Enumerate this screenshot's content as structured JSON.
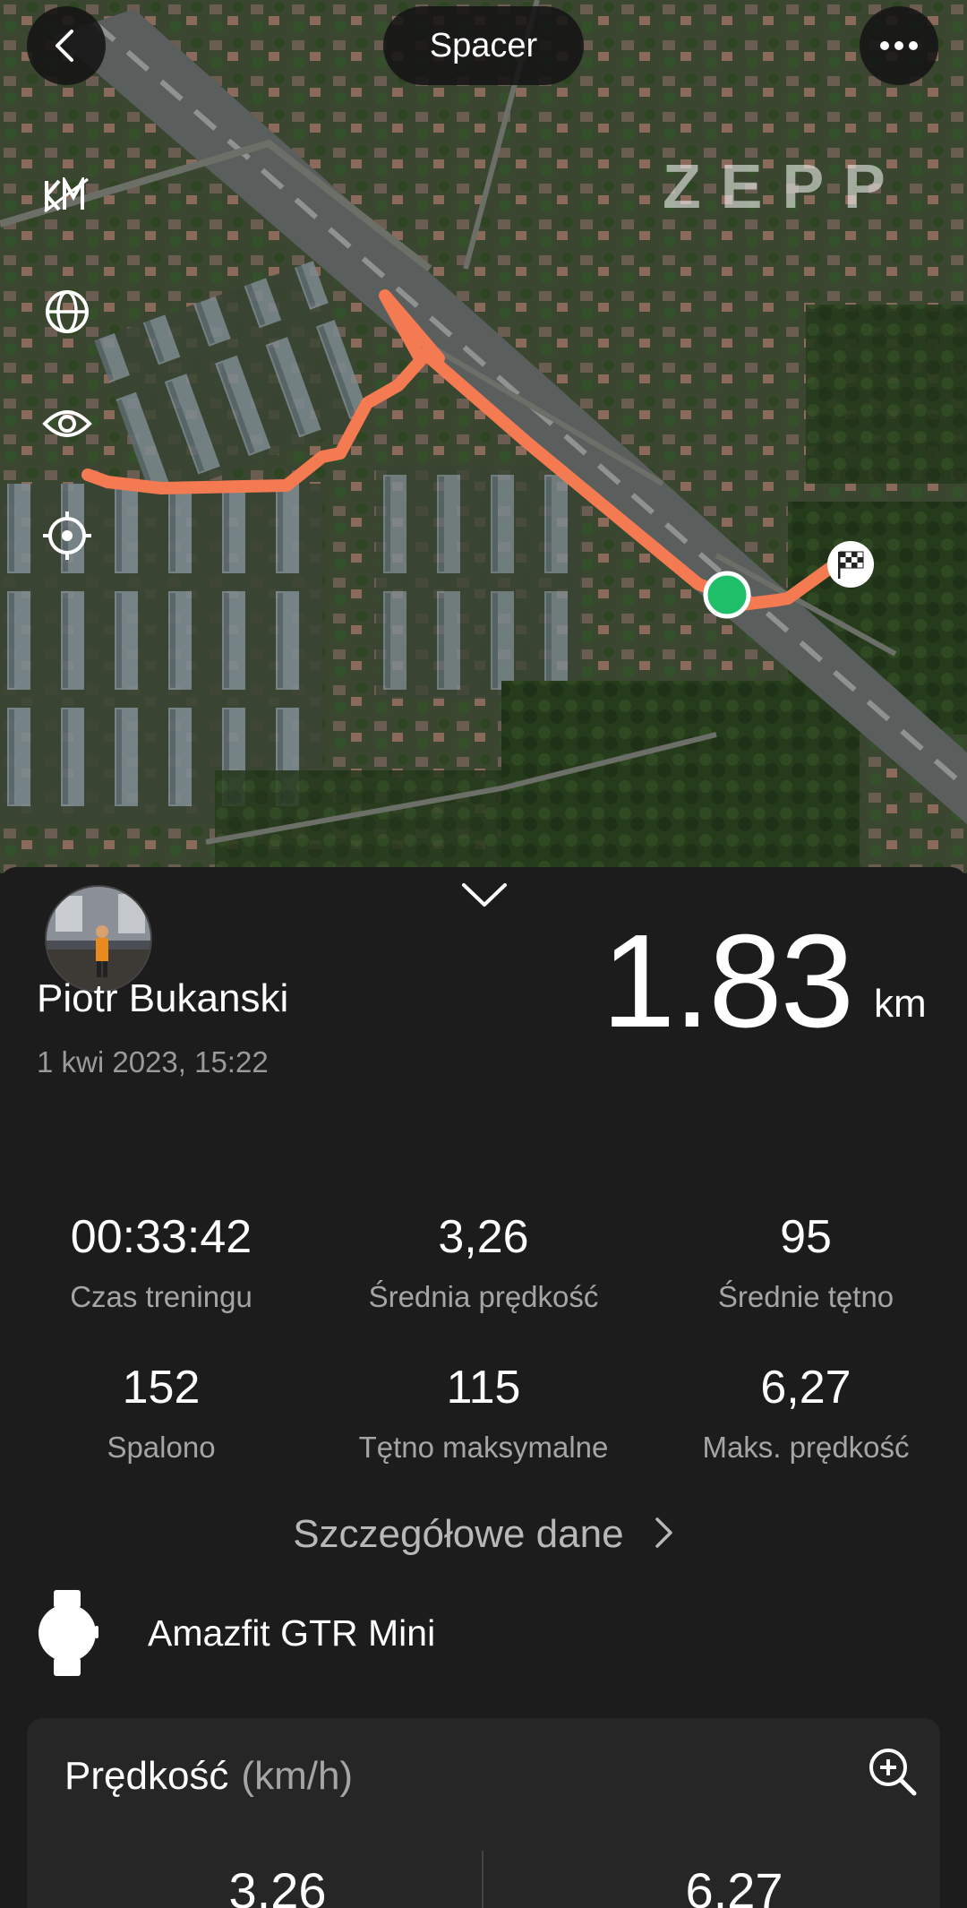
{
  "header": {
    "activity_type": "Spacer",
    "back_icon": "chevron-left-icon",
    "more_icon": "more-horizontal-icon"
  },
  "map": {
    "brand": "ZEPP",
    "tools": [
      "km-markers-icon",
      "globe-icon",
      "eye-icon",
      "locate-icon"
    ],
    "route_color": "#f47a52",
    "start_color": "#1fbf6a"
  },
  "summary": {
    "user_name": "Piotr Bukanski",
    "date": "1 kwi 2023, 15:22",
    "distance_value": "1.83",
    "distance_unit": "km"
  },
  "stats": [
    {
      "value": "00:33:42",
      "label": "Czas treningu"
    },
    {
      "value": "3,26",
      "label": "Średnia prędkość"
    },
    {
      "value": "95",
      "label": "Średnie tętno"
    },
    {
      "value": "152",
      "label": "Spalono"
    },
    {
      "value": "115",
      "label": "Tętno maksymalne"
    },
    {
      "value": "6,27",
      "label": "Maks. prędkość"
    }
  ],
  "details_link": "Szczegółowe dane",
  "device": {
    "name": "Amazfit GTR Mini",
    "icon": "watch-icon"
  },
  "speed_card": {
    "title": "Prędkość",
    "unit": "(km/h)",
    "avg": "3,26",
    "max": "6,27",
    "zoom_icon": "zoom-in-icon"
  }
}
